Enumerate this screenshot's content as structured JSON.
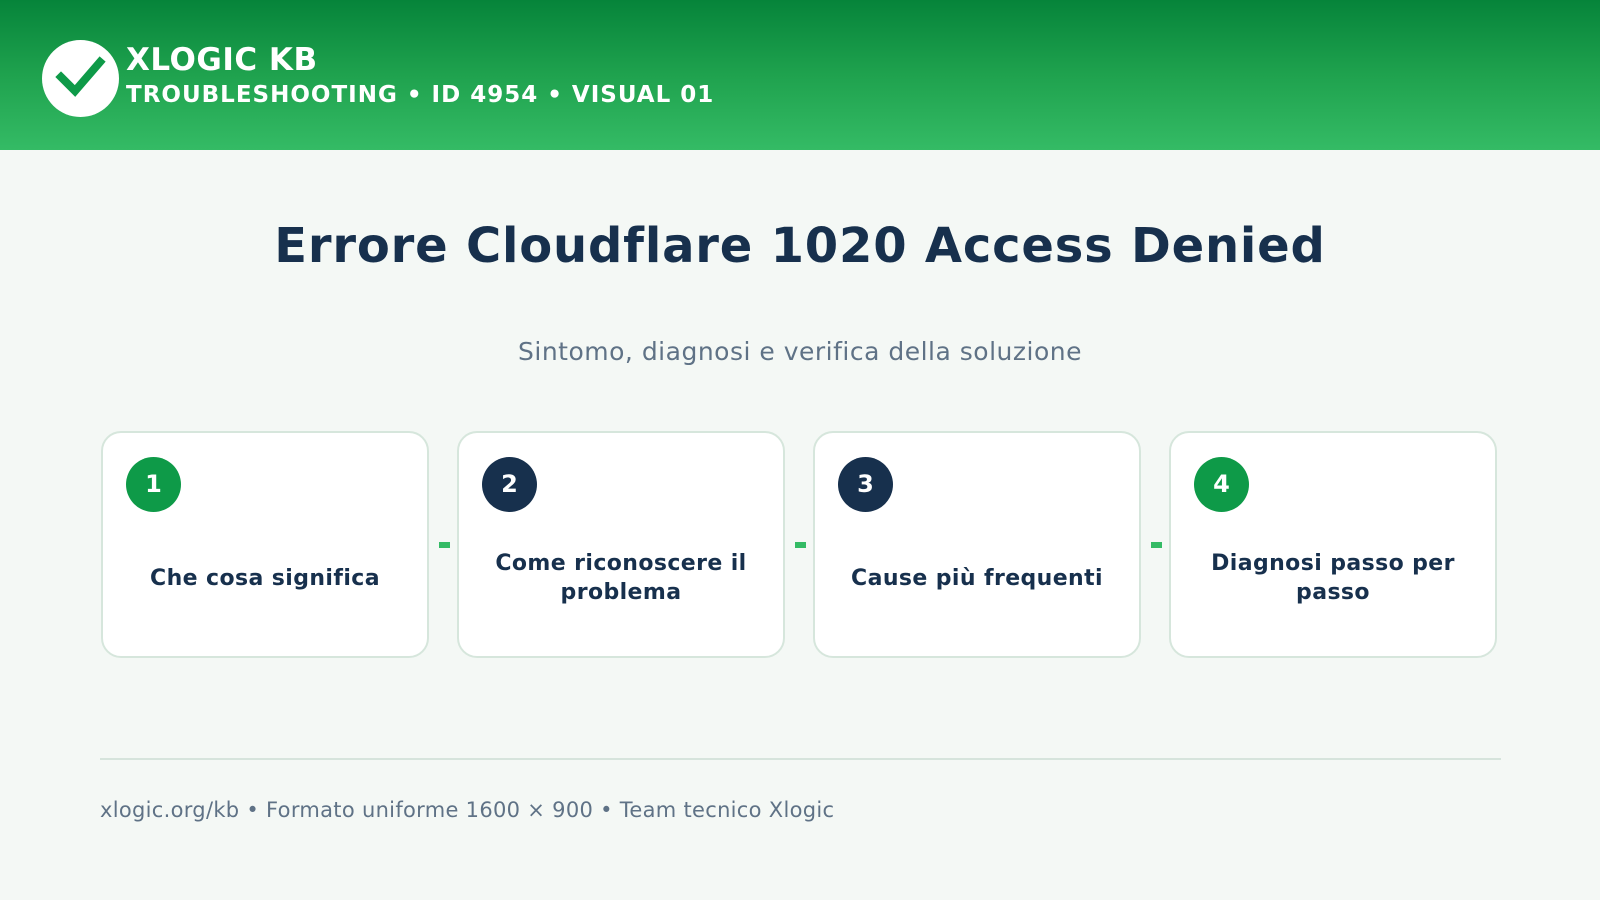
{
  "header": {
    "brand": "XLOGIC KB",
    "subtitle": "TROUBLESHOOTING • ID 4954 • VISUAL 01",
    "logo_icon": "checkmark-icon"
  },
  "main": {
    "title": "Errore Cloudflare 1020 Access Denied",
    "subtitle": "Sintomo, diagnosi e verifica della soluzione"
  },
  "steps": [
    {
      "number": "1",
      "label": "Che cosa significa",
      "badge_color": "#0e9a48"
    },
    {
      "number": "2",
      "label": "Come riconoscere il problema",
      "badge_color": "#17304d"
    },
    {
      "number": "3",
      "label": "Cause più frequenti",
      "badge_color": "#17304d"
    },
    {
      "number": "4",
      "label": "Diagnosi passo per passo",
      "badge_color": "#0e9a48"
    }
  ],
  "footer": {
    "text": "xlogic.org/kb • Formato uniforme 1600 × 900 • Team tecnico Xlogic"
  },
  "colors": {
    "accent_green": "#1fa24e",
    "navy": "#17304d",
    "muted_text": "#5f7286",
    "background": "#f4f8f5"
  }
}
